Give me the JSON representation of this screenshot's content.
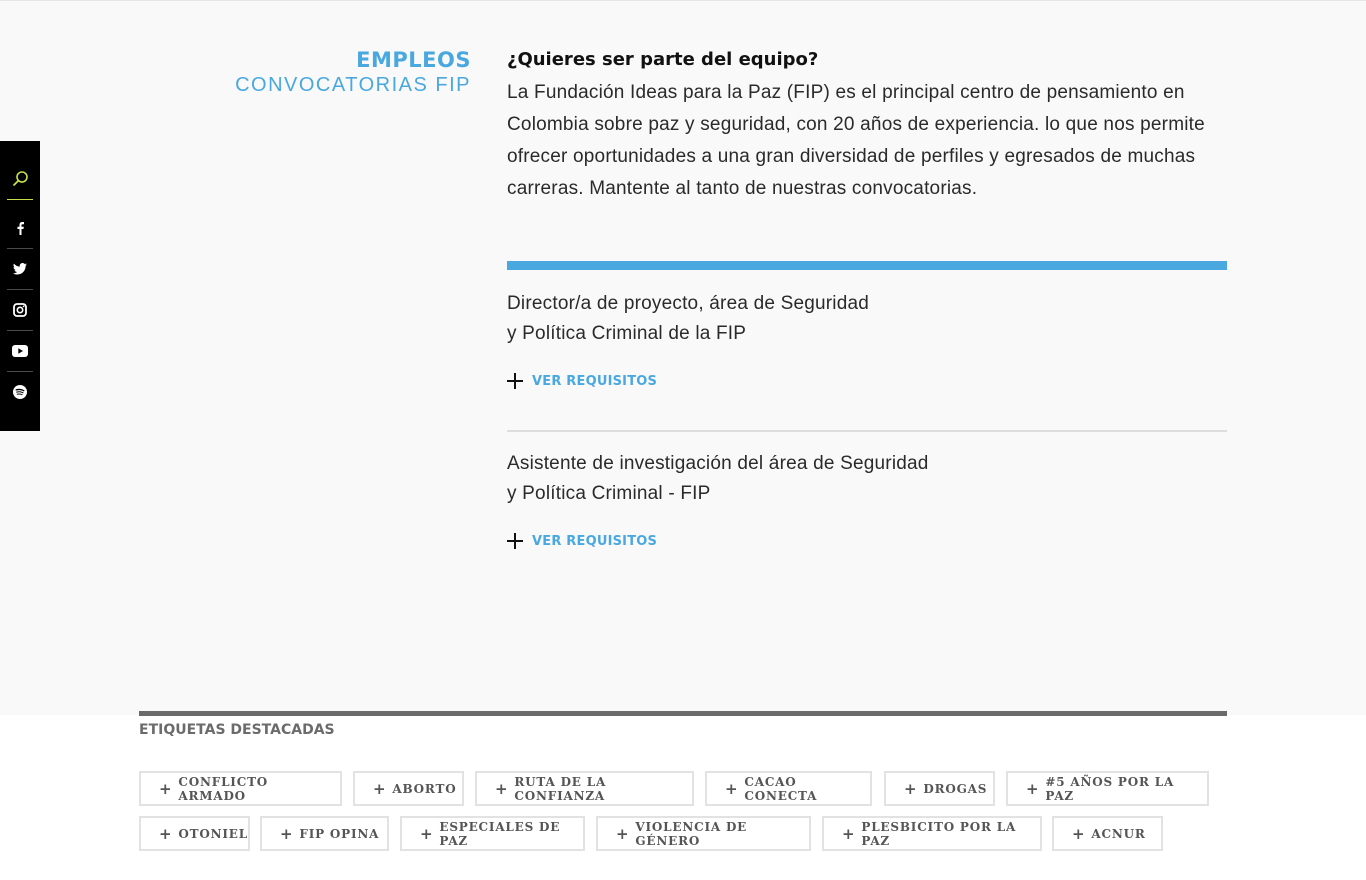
{
  "social": {
    "items": [
      {
        "name": "search-icon"
      },
      {
        "name": "facebook-icon"
      },
      {
        "name": "twitter-icon"
      },
      {
        "name": "instagram-icon"
      },
      {
        "name": "youtube-icon"
      },
      {
        "name": "spotify-icon"
      }
    ],
    "accent": "#c5e04a"
  },
  "section": {
    "title": "EMPLEOS",
    "subtitle": "CONVOCATORIAS FIP",
    "color": "#4aa8e0"
  },
  "intro": {
    "question": "¿Quieres ser parte del equipo?",
    "text": "La Fundación Ideas para la Paz (FIP) es el principal centro de pensamiento en Colombia sobre paz y seguridad, con 20 años de experiencia. lo que nos permite ofrecer oportunidades a una gran diversidad de perfiles y egresados de muchas carreras. Mantente al tanto de nuestras convocatorias."
  },
  "jobs": [
    {
      "title": "Director/a de proyecto, área de Seguridad\ny Política Criminal de la FIP",
      "toggle_label": "VER REQUISITOS"
    },
    {
      "title": "Asistente de investigación del área de Seguridad\ny Política Criminal - FIP",
      "toggle_label": "VER REQUISITOS"
    }
  ],
  "tags": {
    "title": "ETIQUETAS DESTACADAS",
    "items": [
      "CONFLICTO ARMADO",
      "ABORTO",
      "RUTA DE LA CONFIANZA",
      "CACAO CONECTA",
      "DROGAS",
      "#5 AÑOS POR LA PAZ",
      "OTONIEL",
      "FIP OPINA",
      "ESPECIALES DE PAZ",
      "VIOLENCIA DE GÉNERO",
      "PLESBICITO POR LA PAZ",
      "ACNUR"
    ]
  }
}
